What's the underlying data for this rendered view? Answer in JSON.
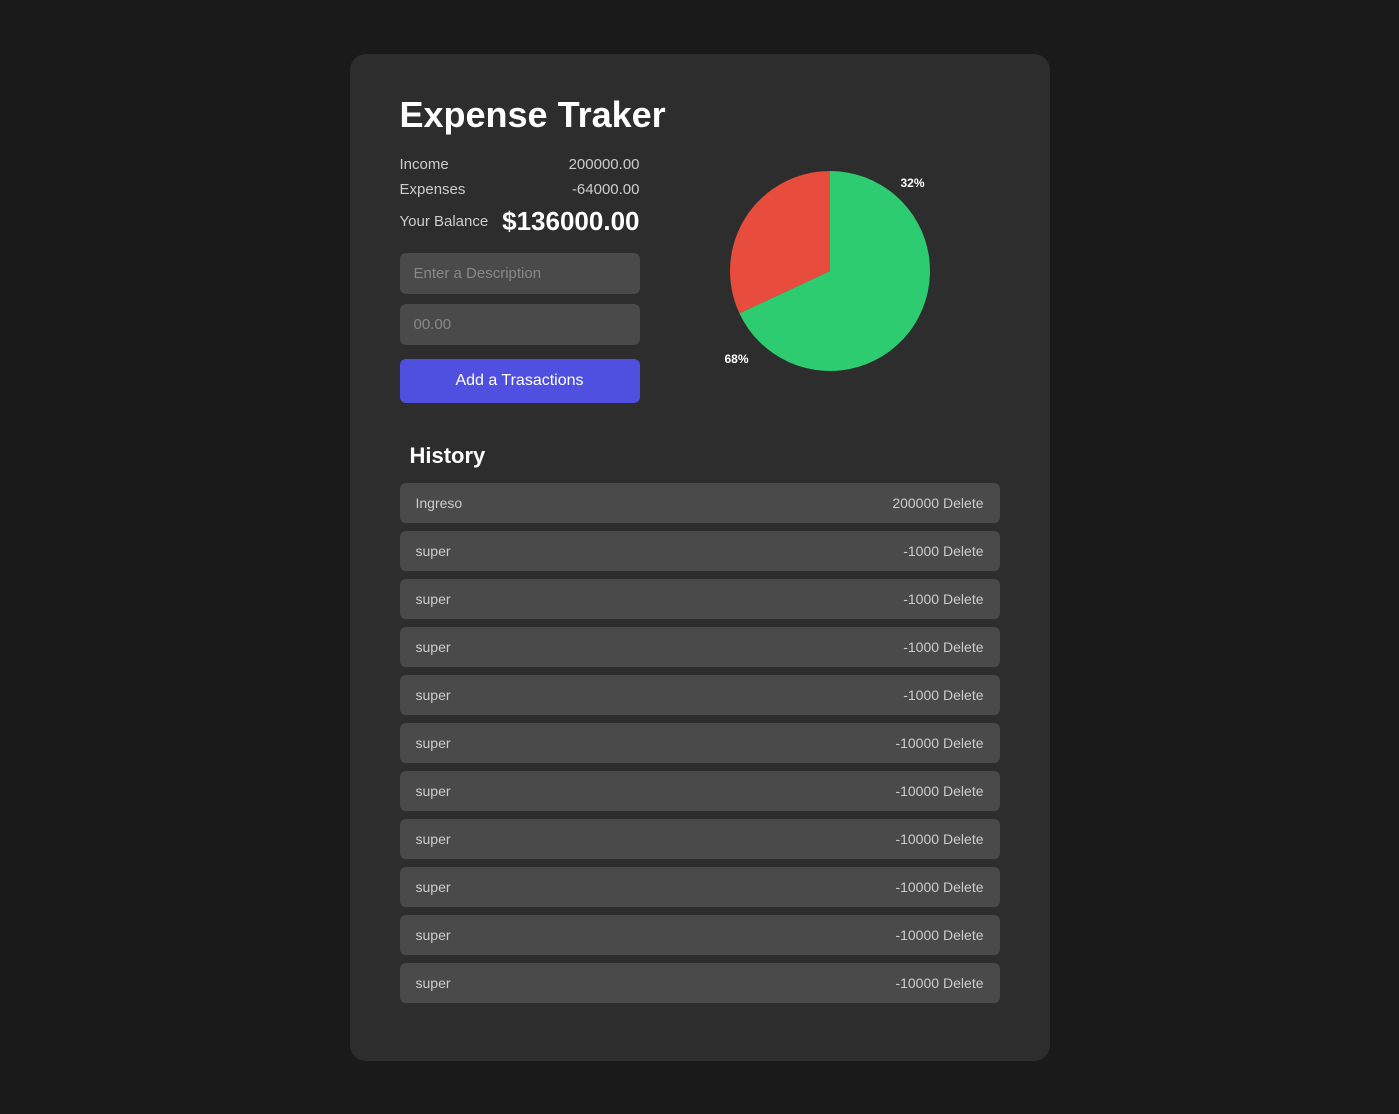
{
  "app": {
    "title": "Expense Traker"
  },
  "stats": {
    "income_label": "Income",
    "income_value": "200000.00",
    "expenses_label": "Expenses",
    "expenses_value": "-64000.00",
    "balance_label": "Your Balance",
    "balance_value": "$136000.00"
  },
  "form": {
    "description_placeholder": "Enter a Description",
    "amount_placeholder": "00.00",
    "add_button_label": "Add a Trasactions"
  },
  "chart": {
    "income_percent": "68%",
    "expense_percent": "32%",
    "income_color": "#2ecc71",
    "expense_color": "#e74c3c"
  },
  "history": {
    "title": "History",
    "items": [
      {
        "name": "Ingreso",
        "amount": "200000",
        "delete": "Delete"
      },
      {
        "name": "super",
        "amount": "-1000",
        "delete": "Delete"
      },
      {
        "name": "super",
        "amount": "-1000",
        "delete": "Delete"
      },
      {
        "name": "super",
        "amount": "-1000",
        "delete": "Delete"
      },
      {
        "name": "super",
        "amount": "-1000",
        "delete": "Delete"
      },
      {
        "name": "super",
        "amount": "-10000",
        "delete": "Delete"
      },
      {
        "name": "super",
        "amount": "-10000",
        "delete": "Delete"
      },
      {
        "name": "super",
        "amount": "-10000",
        "delete": "Delete"
      },
      {
        "name": "super",
        "amount": "-10000",
        "delete": "Delete"
      },
      {
        "name": "super",
        "amount": "-10000",
        "delete": "Delete"
      },
      {
        "name": "super",
        "amount": "-10000",
        "delete": "Delete"
      }
    ]
  }
}
